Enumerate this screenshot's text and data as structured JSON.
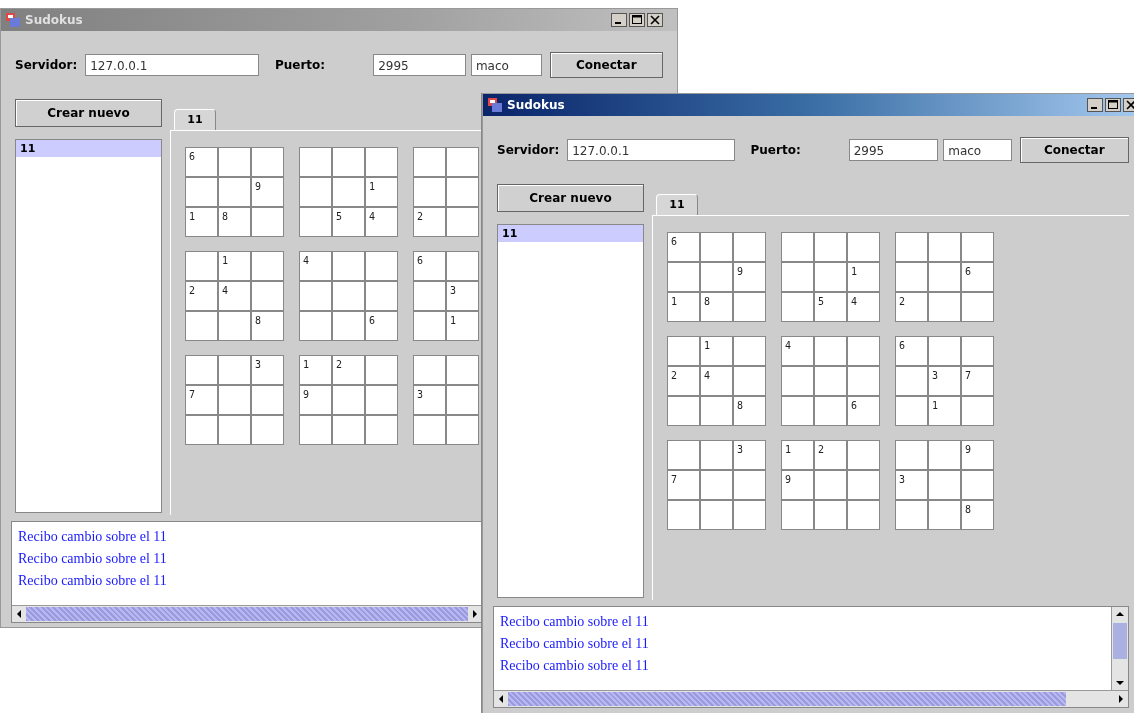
{
  "windows": [
    {
      "title": "Sudokus",
      "active": false,
      "server_label": "Servidor:",
      "server": "127.0.0.1",
      "port_label": "Puerto:",
      "port": "2995",
      "user": "maco",
      "connect_button": "Conectar",
      "create_button": "Crear nuevo",
      "tabs": [
        {
          "label": "11",
          "selected": true
        }
      ],
      "games": [
        {
          "label": "11",
          "selected": true
        }
      ],
      "board": [
        [
          {
            "kind": "given",
            "value": "6"
          },
          {
            "kind": "blank"
          },
          {
            "kind": "blank"
          },
          {
            "kind": "blank"
          },
          {
            "kind": "blank"
          },
          {
            "kind": "blank"
          },
          {
            "kind": "blank"
          },
          {
            "kind": "blank"
          }
        ],
        [
          {
            "kind": "blank"
          },
          {
            "kind": "blank"
          },
          {
            "kind": "given",
            "value": "9"
          },
          {
            "kind": "blank"
          },
          {
            "kind": "blank"
          },
          {
            "kind": "given",
            "value": "1"
          },
          {
            "kind": "blank"
          },
          {
            "kind": "blank"
          }
        ],
        [
          {
            "kind": "given",
            "value": "1"
          },
          {
            "kind": "given",
            "value": "8"
          },
          {
            "kind": "blank"
          },
          {
            "kind": "blank"
          },
          {
            "kind": "given",
            "value": "5"
          },
          {
            "kind": "given",
            "value": "4"
          },
          {
            "kind": "given",
            "value": "2"
          },
          {
            "kind": "blank"
          }
        ],
        [
          {
            "kind": "blank"
          },
          {
            "kind": "given",
            "value": "1"
          },
          {
            "kind": "blank"
          },
          {
            "kind": "given",
            "value": "4"
          },
          {
            "kind": "blank"
          },
          {
            "kind": "blank"
          },
          {
            "kind": "given",
            "value": "6"
          },
          {
            "kind": "blank"
          }
        ],
        [
          {
            "kind": "given",
            "value": "2"
          },
          {
            "kind": "given",
            "value": "4"
          },
          {
            "kind": "blank"
          },
          {
            "kind": "blank"
          },
          {
            "kind": "blank"
          },
          {
            "kind": "blank"
          },
          {
            "kind": "blank"
          },
          {
            "kind": "given",
            "value": "3"
          }
        ],
        [
          {
            "kind": "blank"
          },
          {
            "kind": "blank"
          },
          {
            "kind": "given",
            "value": "8"
          },
          {
            "kind": "blank"
          },
          {
            "kind": "blank"
          },
          {
            "kind": "given",
            "value": "6"
          },
          {
            "kind": "blank"
          },
          {
            "kind": "given",
            "value": "1"
          }
        ],
        [
          {
            "kind": "blank"
          },
          {
            "kind": "blank"
          },
          {
            "kind": "given",
            "value": "3"
          },
          {
            "kind": "given",
            "value": "1"
          },
          {
            "kind": "given",
            "value": "2"
          },
          {
            "kind": "blank"
          },
          {
            "kind": "blank"
          },
          {
            "kind": "blank"
          }
        ],
        [
          {
            "kind": "given",
            "value": "7"
          },
          {
            "kind": "blank"
          },
          {
            "kind": "blank"
          },
          {
            "kind": "given",
            "value": "9"
          },
          {
            "kind": "blank"
          },
          {
            "kind": "blank"
          },
          {
            "kind": "given",
            "value": "3"
          },
          {
            "kind": "blank"
          }
        ],
        [
          {
            "kind": "blank"
          },
          {
            "kind": "blank"
          },
          {
            "kind": "blank"
          },
          {
            "kind": "blank"
          },
          {
            "kind": "blank"
          },
          {
            "kind": "blank"
          },
          {
            "kind": "blank"
          },
          {
            "kind": "blank"
          }
        ]
      ],
      "log": [
        "Recibo cambio sobre el 11",
        "Recibo cambio sobre el 11",
        "Recibo cambio sobre el 11"
      ],
      "log_vertical_scroll": false
    },
    {
      "title": "Sudokus",
      "active": true,
      "server_label": "Servidor:",
      "server": "127.0.0.1",
      "port_label": "Puerto:",
      "port": "2995",
      "user": "maco",
      "connect_button": "Conectar",
      "create_button": "Crear nuevo",
      "tabs": [
        {
          "label": "11",
          "selected": true
        }
      ],
      "games": [
        {
          "label": "11",
          "selected": true
        }
      ],
      "board": [
        [
          {
            "kind": "given",
            "value": "6"
          },
          {
            "kind": "blank"
          },
          {
            "kind": "blank"
          },
          {
            "kind": "blank"
          },
          {
            "kind": "blank"
          },
          {
            "kind": "blank"
          },
          {
            "kind": "blank"
          },
          {
            "kind": "blank"
          },
          {
            "kind": "blank"
          }
        ],
        [
          {
            "kind": "blank"
          },
          {
            "kind": "blank"
          },
          {
            "kind": "given",
            "value": "9"
          },
          {
            "kind": "blank"
          },
          {
            "kind": "blank"
          },
          {
            "kind": "given",
            "value": "1"
          },
          {
            "kind": "blank"
          },
          {
            "kind": "blank"
          },
          {
            "kind": "given",
            "value": "6"
          }
        ],
        [
          {
            "kind": "given",
            "value": "1"
          },
          {
            "kind": "given",
            "value": "8"
          },
          {
            "kind": "blank"
          },
          {
            "kind": "blank"
          },
          {
            "kind": "given",
            "value": "5"
          },
          {
            "kind": "given",
            "value": "4"
          },
          {
            "kind": "given",
            "value": "2"
          },
          {
            "kind": "blank"
          },
          {
            "kind": "blank"
          }
        ],
        [
          {
            "kind": "blank"
          },
          {
            "kind": "given",
            "value": "1"
          },
          {
            "kind": "blank"
          },
          {
            "kind": "given",
            "value": "4"
          },
          {
            "kind": "blank"
          },
          {
            "kind": "blank"
          },
          {
            "kind": "given",
            "value": "6"
          },
          {
            "kind": "blank"
          },
          {
            "kind": "blank"
          }
        ],
        [
          {
            "kind": "given",
            "value": "2"
          },
          {
            "kind": "given",
            "value": "4"
          },
          {
            "kind": "blank"
          },
          {
            "kind": "blank"
          },
          {
            "kind": "blank"
          },
          {
            "kind": "blank"
          },
          {
            "kind": "blank"
          },
          {
            "kind": "given",
            "value": "3"
          },
          {
            "kind": "given",
            "value": "7"
          }
        ],
        [
          {
            "kind": "blank"
          },
          {
            "kind": "blank"
          },
          {
            "kind": "given",
            "value": "8"
          },
          {
            "kind": "blank"
          },
          {
            "kind": "blank"
          },
          {
            "kind": "given",
            "value": "6"
          },
          {
            "kind": "blank"
          },
          {
            "kind": "given",
            "value": "1"
          },
          {
            "kind": "blank"
          }
        ],
        [
          {
            "kind": "blank"
          },
          {
            "kind": "blank"
          },
          {
            "kind": "given",
            "value": "3"
          },
          {
            "kind": "given",
            "value": "1"
          },
          {
            "kind": "given",
            "value": "2"
          },
          {
            "kind": "blank"
          },
          {
            "kind": "blank"
          },
          {
            "kind": "blank"
          },
          {
            "kind": "given",
            "value": "9"
          }
        ],
        [
          {
            "kind": "given",
            "value": "7"
          },
          {
            "kind": "blank"
          },
          {
            "kind": "blank"
          },
          {
            "kind": "given",
            "value": "9"
          },
          {
            "kind": "blank"
          },
          {
            "kind": "blank"
          },
          {
            "kind": "given",
            "value": "3"
          },
          {
            "kind": "blank"
          },
          {
            "kind": "blank"
          }
        ],
        [
          {
            "kind": "blank"
          },
          {
            "kind": "blank"
          },
          {
            "kind": "blank"
          },
          {
            "kind": "blank"
          },
          {
            "kind": "blank"
          },
          {
            "kind": "blank"
          },
          {
            "kind": "blank"
          },
          {
            "kind": "blank"
          },
          {
            "kind": "given",
            "value": "8"
          }
        ]
      ],
      "log": [
        "Recibo cambio sobre el 11",
        "Recibo cambio sobre el 11",
        "Recibo cambio sobre el 11"
      ],
      "log_vertical_scroll": true
    }
  ]
}
